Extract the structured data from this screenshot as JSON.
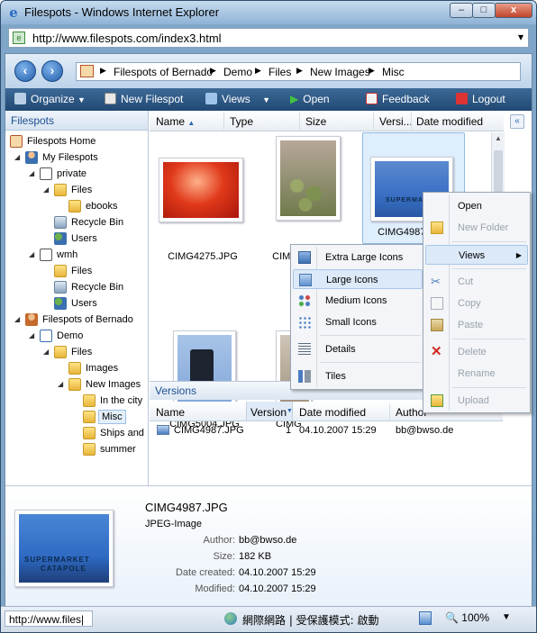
{
  "window": {
    "title": "Filespots - Windows Internet Explorer",
    "minimize": "–",
    "maximize": "□",
    "close": "x"
  },
  "address": {
    "url": "http://www.filespots.com/index3.html",
    "dropdown": "▾"
  },
  "breadcrumb": [
    "Filespots of Bernado",
    "Demo",
    "Files",
    "New Images",
    "Misc"
  ],
  "toolbar": {
    "organize": "Organize",
    "new_filespot": "New Filespot",
    "views": "Views",
    "open": "Open",
    "feedback": "Feedback",
    "logout": "Logout"
  },
  "tree": {
    "header": "Filespots",
    "items": [
      "Filespots Home",
      "My Filespots",
      "private",
      "Files",
      "ebooks",
      "Recycle Bin",
      "Users",
      "wmh",
      "Files",
      "Recycle Bin",
      "Users",
      "Filespots of Bernado",
      "Demo",
      "Files",
      "Images",
      "New Images",
      "In the city",
      "Misc",
      "Ships and",
      "summer"
    ]
  },
  "columns": {
    "name": "Name",
    "type": "Type",
    "size": "Size",
    "version": "Versi...",
    "date_modified": "Date modified"
  },
  "files": [
    "CIMG4275.JPG",
    "CIMG4977.JPG",
    "CIMG4987.JPG",
    "CIMG5004.JPG",
    "CIMG"
  ],
  "versions": {
    "header": "Versions",
    "columns": {
      "name": "Name",
      "version": "Version",
      "date_modified": "Date modified",
      "author": "Author"
    },
    "rows": [
      {
        "name": "CIMG4987.JPG",
        "version": "1",
        "date": "04.10.2007 15:29",
        "author": "bb@bwso.de"
      }
    ]
  },
  "details": {
    "filename": "CIMG4987.JPG",
    "filetype": "JPEG-Image",
    "labels": {
      "author": "Author:",
      "size": "Size:",
      "created": "Date created:",
      "modified": "Modified:"
    },
    "values": {
      "author": "bb@bwso.de",
      "size": "182 KB",
      "created": "04.10.2007 15:29",
      "modified": "04.10.2007 15:29"
    }
  },
  "thumb_text": {
    "line1": "SUPERMARKET",
    "line2": "CATAPOLE"
  },
  "context_menu": {
    "open": "Open",
    "new_folder": "New Folder",
    "views": "Views",
    "cut": "Cut",
    "copy": "Copy",
    "paste": "Paste",
    "delete": "Delete",
    "rename": "Rename",
    "upload": "Upload"
  },
  "views_submenu": {
    "extra_large": "Extra Large Icons",
    "large": "Large Icons",
    "medium": "Medium Icons",
    "small": "Small Icons",
    "details": "Details",
    "tiles": "Tiles"
  },
  "status": {
    "url": "http://www.files|",
    "zone": "網際網路 | 受保護模式: 啟動",
    "zoom": "100%"
  },
  "colors": {
    "toolbar": "#214873",
    "accent": "#1d4f91",
    "selection": "#dfeefc"
  }
}
